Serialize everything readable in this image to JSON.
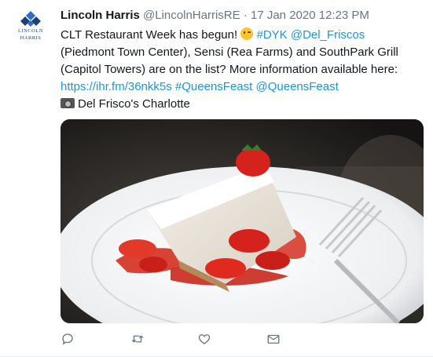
{
  "author": {
    "name": "Lincoln Harris",
    "handle": "@LincolnHarrisRE",
    "separator": "·",
    "timestamp": "17 Jan 2020 12:23 PM",
    "logo_text_line1": "LINCOLN",
    "logo_text_line2": "HARRIS"
  },
  "tweet": {
    "text_part1": "CLT Restaurant Week has begun! ",
    "hashtag_dyk": "#DYK",
    "mention_delfriscos": "@Del_Friscos",
    "text_part2": " (Piedmont Town Center), Sensi (Rea Farms) and SouthPark Grill (Capitol Towers) are on the list? More information available here: ",
    "link_url": "https://ihr.fm/36nkk5s",
    "hashtag_queensfeast": "#QueensFeast",
    "mention_queensfeast": "@QueensFeast",
    "location_line": "Del Frisco's Charlotte"
  },
  "media": {
    "description_icon": "photo-of-cheesecake-with-strawberries"
  },
  "actions": [
    {
      "name": "reply",
      "icon": "speech-bubble-icon"
    },
    {
      "name": "retweet",
      "icon": "retweet-arrows-icon"
    },
    {
      "name": "like",
      "icon": "heart-icon"
    },
    {
      "name": "share",
      "icon": "envelope-icon"
    }
  ],
  "colors": {
    "link": "#1b95e0",
    "muted": "#657786",
    "text": "#14171a",
    "icon": "#657786"
  }
}
